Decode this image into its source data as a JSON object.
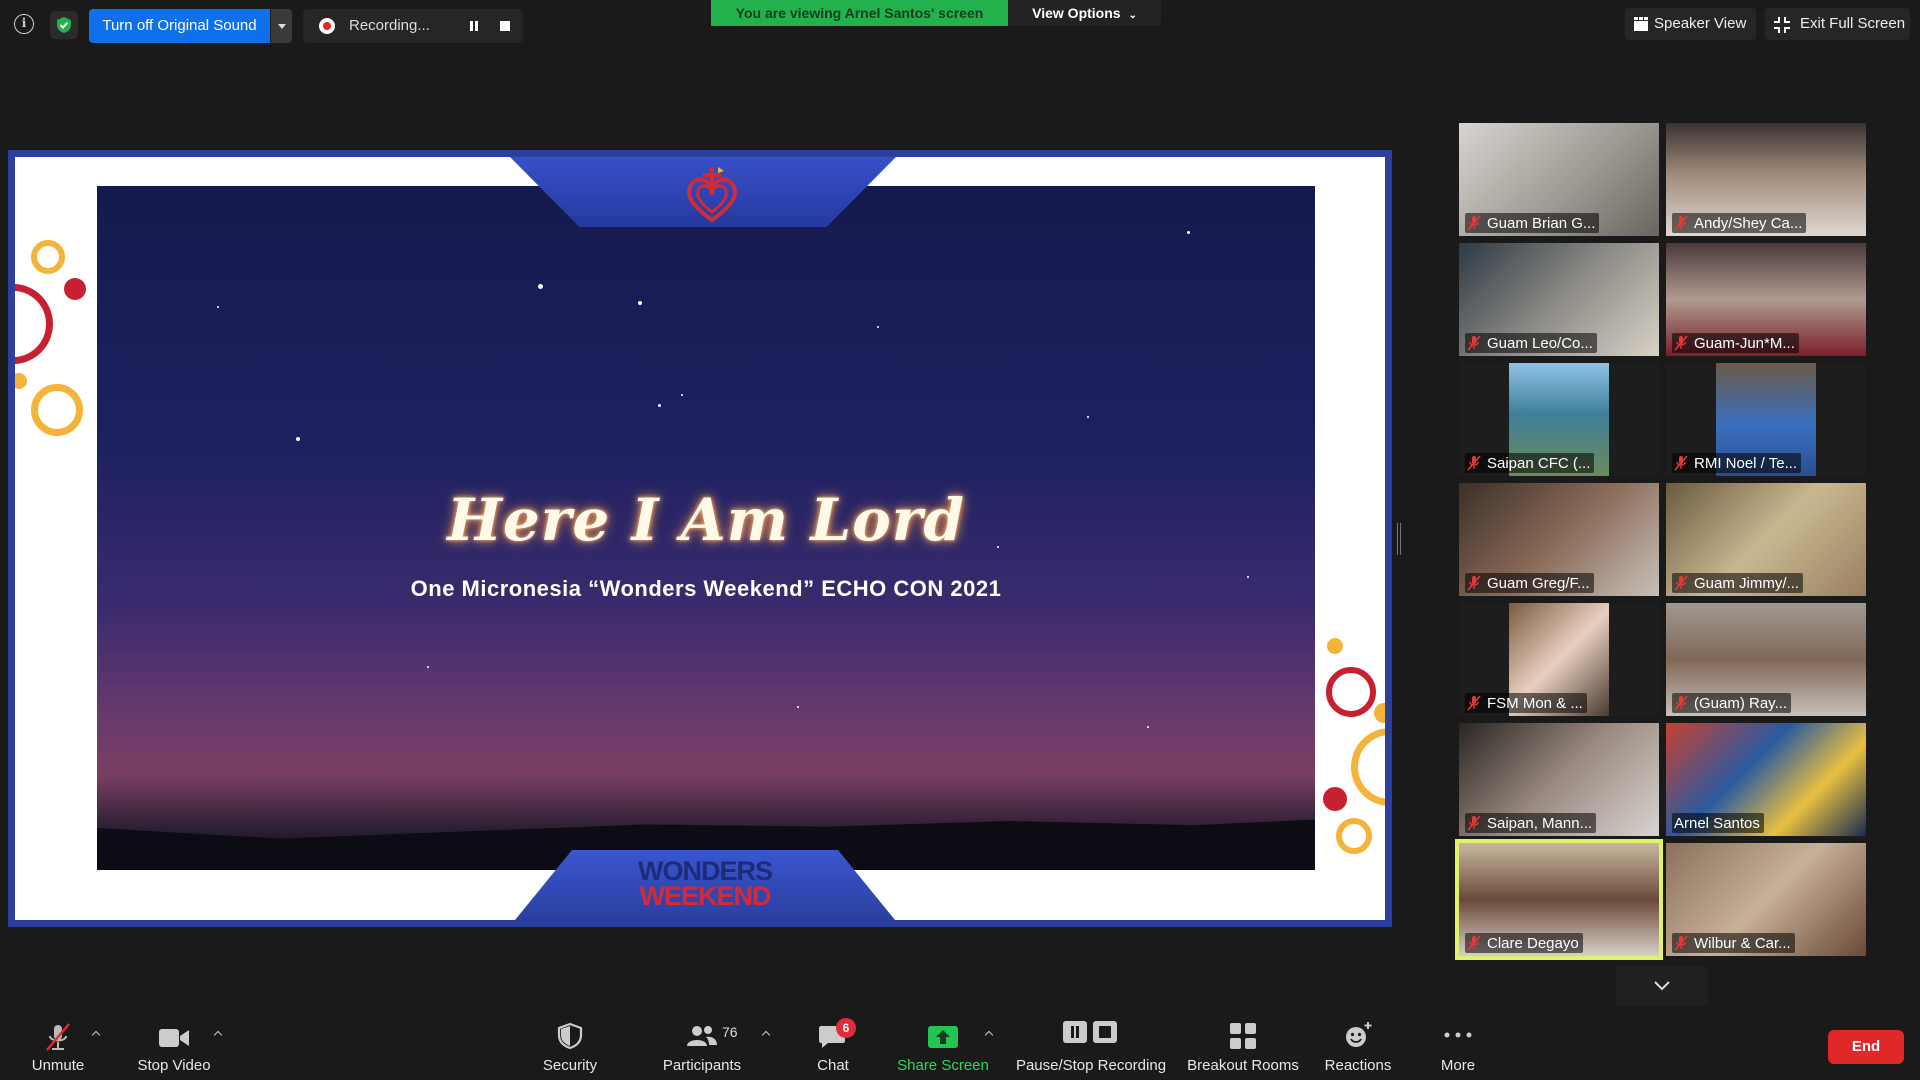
{
  "topbar": {
    "original_sound_label": "Turn off Original Sound",
    "recording_label": "Recording...",
    "viewing_banner": "You are viewing Arnel Santos' screen",
    "view_options_label": "View Options",
    "speaker_view_label": "Speaker View",
    "exit_full_screen_label": "Exit Full Screen"
  },
  "shared_screen": {
    "title": "Here I Am Lord",
    "subtitle": "One Micronesia “Wonders Weekend” ECHO CON 2021",
    "banner_line1": "WONDERS",
    "banner_line2": "WEEKEND"
  },
  "participants": [
    {
      "name": "Guam Brian G...",
      "muted": true
    },
    {
      "name": "Andy/Shey Ca...",
      "muted": true
    },
    {
      "name": "Guam Leo/Co...",
      "muted": true
    },
    {
      "name": "Guam-Jun*M...",
      "muted": true
    },
    {
      "name": "Saipan CFC (...",
      "muted": true
    },
    {
      "name": "RMI Noel / Te...",
      "muted": true
    },
    {
      "name": "Guam Greg/F...",
      "muted": true
    },
    {
      "name": "Guam Jimmy/...",
      "muted": true
    },
    {
      "name": "FSM Mon & ...",
      "muted": true
    },
    {
      "name": "(Guam) Ray...",
      "muted": true
    },
    {
      "name": "Saipan, Mann...",
      "muted": true
    },
    {
      "name": "Arnel Santos",
      "muted": false
    },
    {
      "name": "Clare Degayo",
      "muted": true
    },
    {
      "name": "Wilbur & Car...",
      "muted": true
    }
  ],
  "toolbar": {
    "unmute_label": "Unmute",
    "stop_video_label": "Stop Video",
    "security_label": "Security",
    "participants_label": "Participants",
    "participants_count": "76",
    "chat_label": "Chat",
    "chat_badge": "6",
    "share_screen_label": "Share Screen",
    "pause_stop_recording_label": "Pause/Stop Recording",
    "breakout_rooms_label": "Breakout Rooms",
    "reactions_label": "Reactions",
    "more_label": "More",
    "end_label": "End"
  },
  "colors": {
    "accent_blue": "#0e71eb",
    "viewing_green": "#23b14d",
    "share_green": "#23c552",
    "end_red": "#e02828",
    "active_speaker": "#dff26a"
  }
}
